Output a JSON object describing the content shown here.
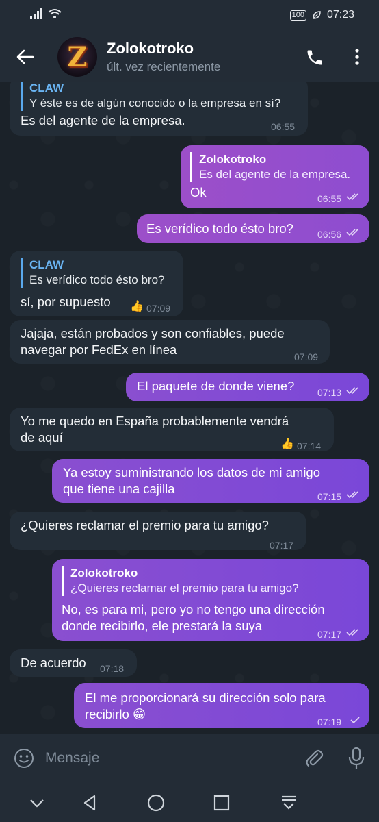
{
  "status_bar": {
    "battery": "100",
    "time": "07:23"
  },
  "header": {
    "name": "Zolokotroko",
    "status": "últ. vez recientemente",
    "avatar_letter": "Z"
  },
  "messages": [
    {
      "dir": "in",
      "reply_name": "CLAW",
      "reply_text": "Y éste es de algún conocido o la empresa en sí?",
      "lines": [
        "Es del agente de la empresa."
      ],
      "time": "06:55"
    },
    {
      "dir": "out",
      "reply_name": "Zolokotroko",
      "reply_text": "Es del agente de la empresa.",
      "lines": [
        "Ok"
      ],
      "time": "06:55",
      "ticks": "double"
    },
    {
      "dir": "out",
      "lines": [
        "Es verídico todo ésto bro?"
      ],
      "time": "06:56",
      "ticks": "double"
    },
    {
      "dir": "in",
      "reply_name": "CLAW",
      "reply_text": "Es verídico todo ésto bro?",
      "lines": [
        "sí, por supuesto"
      ],
      "reaction": "👍",
      "time": "07:09"
    },
    {
      "dir": "in",
      "lines": [
        "Jajaja, están probados y son confiables, puede",
        "navegar por FedEx en línea"
      ],
      "time": "07:09"
    },
    {
      "dir": "out",
      "lines": [
        "El paquete de donde viene?"
      ],
      "time": "07:13",
      "ticks": "double"
    },
    {
      "dir": "in",
      "lines": [
        "Yo me quedo en España probablemente vendrá",
        "de aquí"
      ],
      "reaction": "👍",
      "time": "07:14"
    },
    {
      "dir": "out",
      "lines": [
        "Ya estoy suministrando los datos de mi amigo",
        "que tiene una cajilla"
      ],
      "time": "07:15",
      "ticks": "double"
    },
    {
      "dir": "in",
      "lines": [
        "¿Quieres reclamar el premio para tu amigo?"
      ],
      "time": "07:17"
    },
    {
      "dir": "out",
      "reply_name": "Zolokotroko",
      "reply_text": "¿Quieres reclamar el premio para tu amigo?",
      "lines": [
        "No, es para mi, pero yo no tengo una dirección",
        "donde recibirlo, ele prestará la suya"
      ],
      "time": "07:17",
      "ticks": "double"
    },
    {
      "dir": "in",
      "lines": [
        "De acuerdo"
      ],
      "time": "07:18"
    },
    {
      "dir": "out",
      "lines": [
        "El me proporcionará su dirección solo para",
        "recibirlo 😁"
      ],
      "time": "07:19",
      "ticks": "single"
    }
  ],
  "input": {
    "placeholder": "Mensaje"
  },
  "icons": {
    "back": "arrow-left-icon",
    "call": "phone-icon",
    "menu": "more-vert-icon",
    "emoji": "smiley-icon",
    "attach": "paperclip-icon",
    "mic": "microphone-icon"
  },
  "colors": {
    "background": "#1b2229",
    "bar": "#232c36",
    "incoming_bubble": "#232d37",
    "outgoing_bubble": "#8a4fd0",
    "reply_accent": "#6ab4f2"
  }
}
